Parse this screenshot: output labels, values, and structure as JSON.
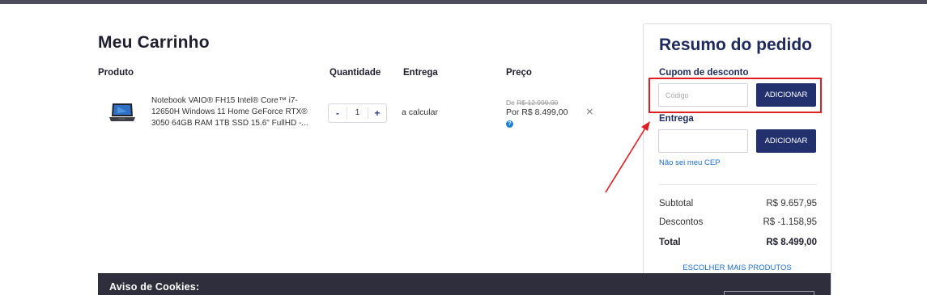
{
  "cart": {
    "title": "Meu Carrinho",
    "columns": {
      "product": "Produto",
      "quantity": "Quantidade",
      "delivery": "Entrega",
      "price": "Preço"
    },
    "item": {
      "name": "Notebook VAIO® FH15 Intel® Core™ i7-12650H Windows 11 Home GeForce RTX® 3050 64GB RAM 1TB SSD 15.6\" FullHD -...",
      "qty_minus": "-",
      "qty": "1",
      "qty_plus": "+",
      "delivery": "a calcular",
      "price_old_prefix": "De ",
      "price_old": "R$ 12.990,00",
      "price_new": "Por R$ 8.499,00",
      "help_icon": "?",
      "remove_icon": "×"
    }
  },
  "summary": {
    "title": "Resumo do pedido",
    "coupon_label": "Cupom de desconto",
    "coupon_placeholder": "Código",
    "coupon_button": "ADICIONAR",
    "delivery_label": "Entrega",
    "delivery_placeholder": "",
    "delivery_button": "ADICIONAR",
    "dont_know_cep": "Não sei meu CEP",
    "subtotal_label": "Subtotal",
    "subtotal_value": "R$ 9.657,95",
    "discounts_label": "Descontos",
    "discounts_value": "R$ -1.158,95",
    "total_label": "Total",
    "total_value": "R$ 8.499,00",
    "more_products": "ESCOLHER MAIS PRODUTOS"
  },
  "cookies": {
    "title": "Aviso de Cookies:"
  },
  "colors": {
    "brand_navy": "#23306e",
    "link_blue": "#1e6fd0",
    "annotation_red": "#e02020",
    "cookie_bar": "#2e2e3c"
  }
}
